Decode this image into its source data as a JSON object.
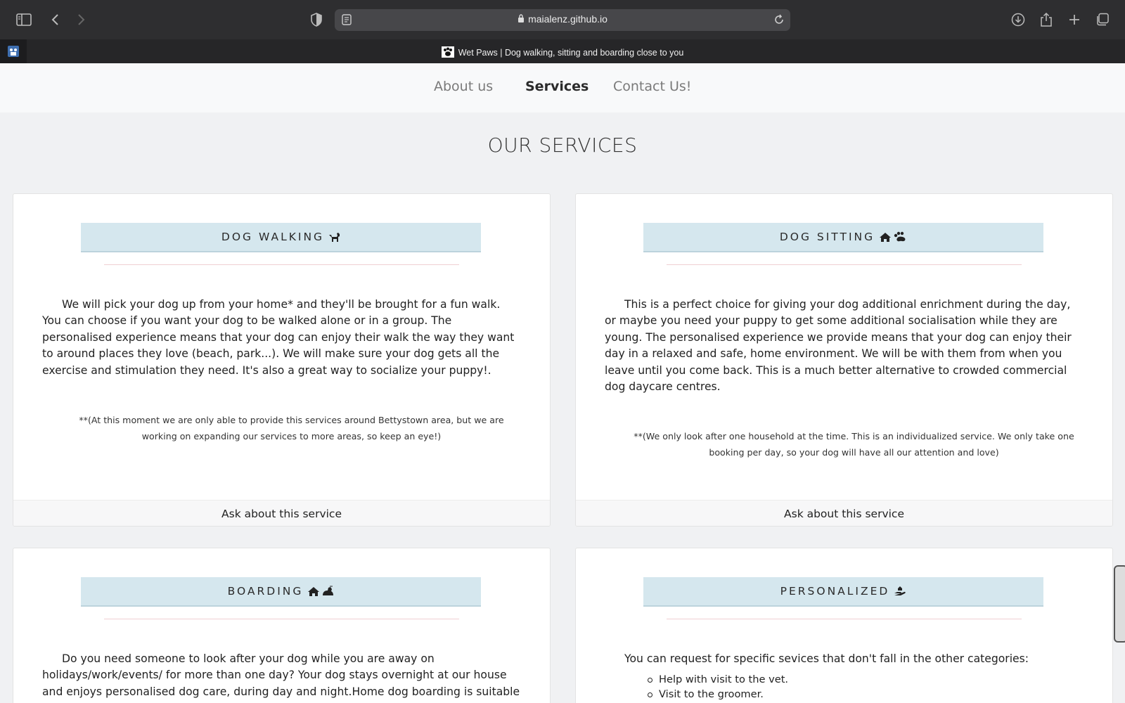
{
  "browser": {
    "url": "maialenz.github.io",
    "tab_title": "Wet Paws | Dog walking, sitting and boarding close to you"
  },
  "nav": {
    "items": [
      {
        "label": "About us",
        "active": false
      },
      {
        "label": "Services",
        "active": true
      },
      {
        "label": "Contact Us!",
        "active": false
      }
    ]
  },
  "page": {
    "title": "OUR SERVICES"
  },
  "cards": [
    {
      "header": "DOG WALKING",
      "icon": "dog-icon",
      "body": "We will pick your dog up from your home* and they'll be brought for a fun walk. You can choose if you want your dog to be walked alone or in a group. The personalised experience means that your dog can enjoy their walk the way they want to around places they love (beach, park...). We will make sure your dog gets all the exercise and stimulation they need. It's also a great way to socialize your puppy!.",
      "note": "**(At this moment we are only able to provide this services around Bettystown area, but we are working on expanding our services to more areas, so keep an eye!)",
      "footer": "Ask about this service"
    },
    {
      "header": "DOG SITTING",
      "icon": "house-paw-icon",
      "body": "This is a perfect choice for giving your dog additional enrichment during the day, or maybe you need your puppy to get some additional socialisation while they are young. The personalised experience we provide means that your dog can enjoy their day in a relaxed and safe, home environment. We will be with them from when you leave until you come back. This is a much better alternative to crowded commercial dog daycare centres.",
      "note": "**(We only look after one household at the time. This is an individualized service. We only take one booking per day, so your dog will have all our attention and love)",
      "footer": "Ask about this service"
    },
    {
      "header": "BOARDING",
      "icon": "house-moon-icon",
      "body": "Do you need someone to look after your dog while you are away on holidays/work/events/ for more than one day? Your dog stays overnight at our house and enjoys personalised dog care, during day and night.Home dog boarding is suitable"
    },
    {
      "header": "PERSONALIZED",
      "icon": "hand-holding-icon",
      "body": "You can request for specific sevices that don't fall in the other categories:",
      "list": [
        "Help with visit to the vet.",
        "Visit to the groomer."
      ]
    }
  ]
}
